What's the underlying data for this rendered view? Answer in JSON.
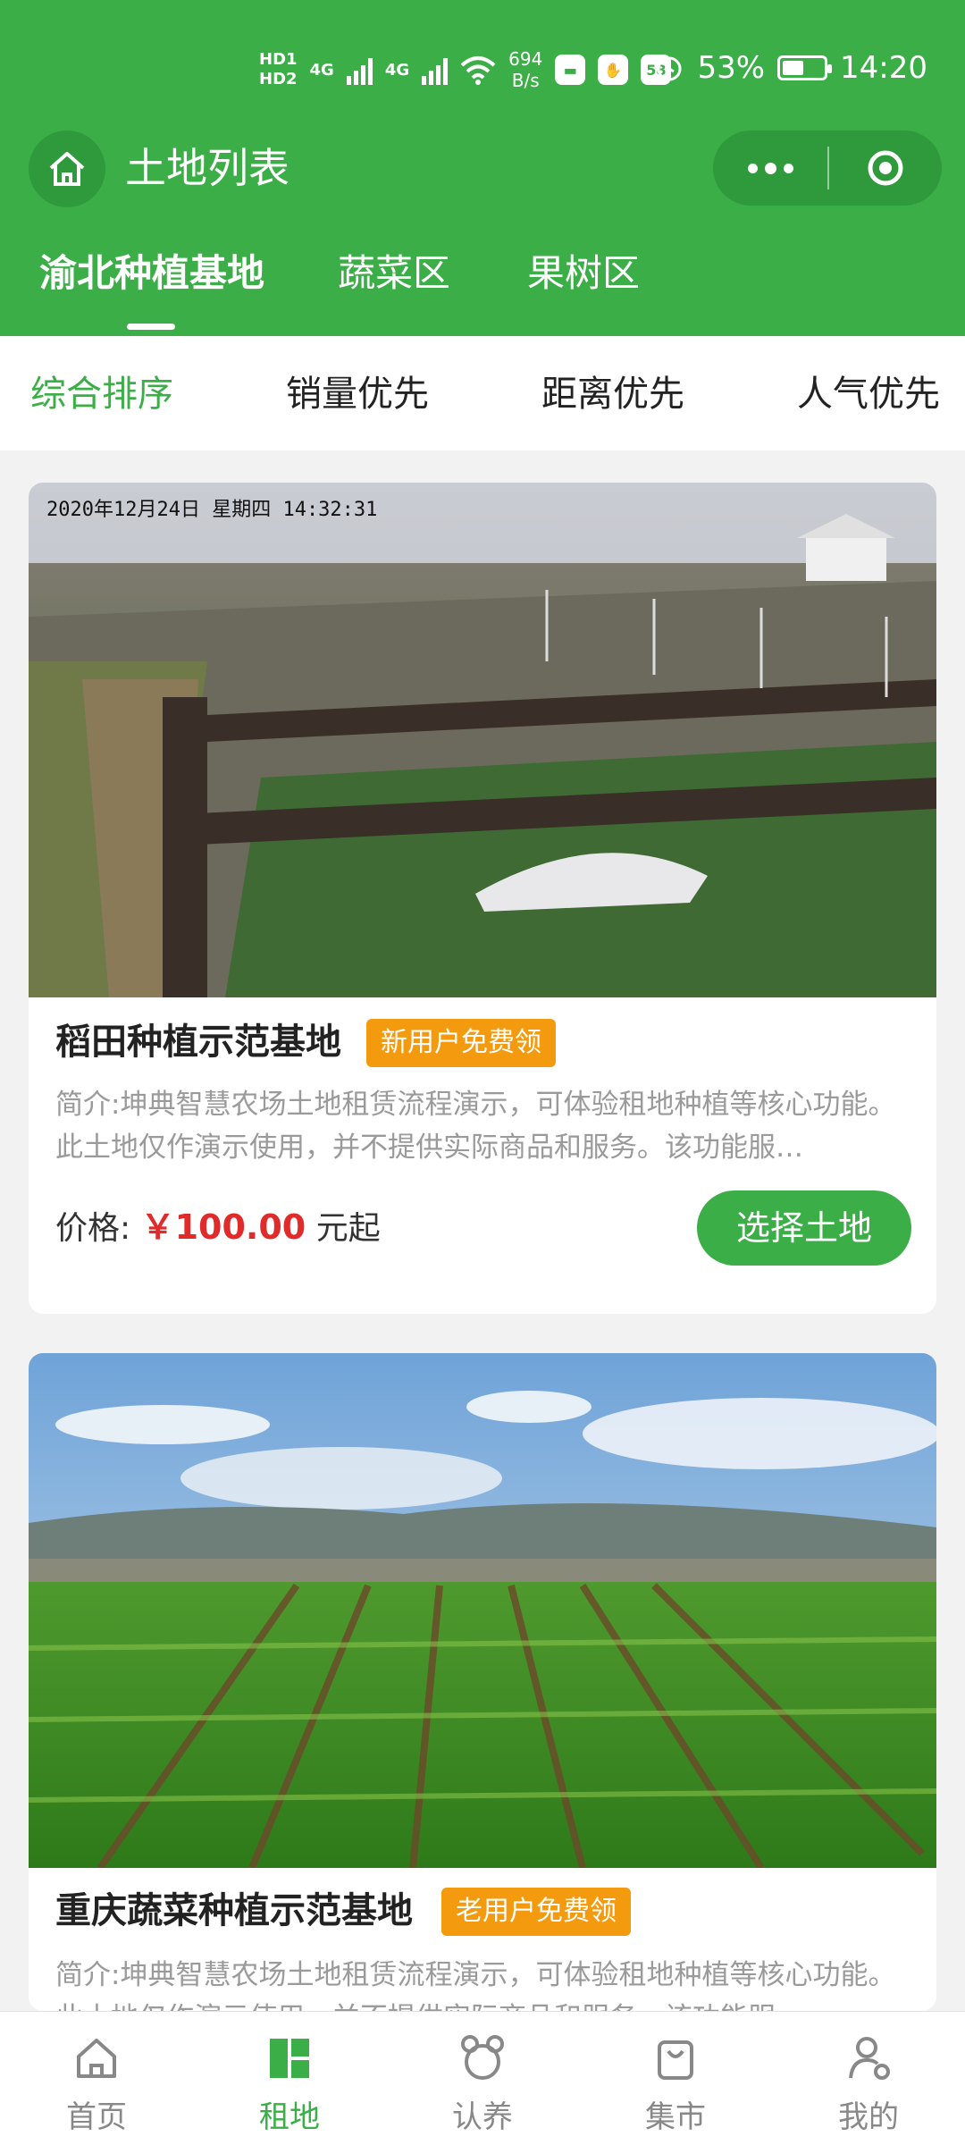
{
  "status_bar": {
    "hd1": "HD1",
    "hd2": "HD2",
    "net1": "4G",
    "net2": "4G",
    "speed_value": "694",
    "speed_unit": "B/s",
    "app_badge": "58",
    "battery": "53%",
    "battery_level": 0.53,
    "time": "14:20"
  },
  "nav": {
    "title": "土地列表"
  },
  "tabs": [
    {
      "label": "渝北种植基地",
      "active": true
    },
    {
      "label": "蔬菜区",
      "active": false
    },
    {
      "label": "果树区",
      "active": false
    }
  ],
  "sort": [
    {
      "label": "综合排序",
      "active": true
    },
    {
      "label": "销量优先",
      "active": false
    },
    {
      "label": "距离优先",
      "active": false
    },
    {
      "label": "人气优先",
      "active": false
    }
  ],
  "cards": [
    {
      "image_timestamp": "2020年12月24日  星期四  14:32:31",
      "title": "稻田种植示范基地",
      "badge": "新用户免费领",
      "desc": "简介:坤典智慧农场土地租赁流程演示，可体验租地种植等核心功能。此土地仅作演示使用，并不提供实际商品和服务。该功能服…",
      "price_label": "价格:",
      "price": "￥100.00",
      "price_unit": "元起",
      "button": "选择土地"
    },
    {
      "title": "重庆蔬菜种植示范基地",
      "badge": "老用户免费领",
      "desc": "简介:坤典智慧农场土地租赁流程演示，可体验租地种植等核心功能。此土地仅作演示使用，并不提供实际商品和服务。该功能服…"
    }
  ],
  "tabbar": [
    {
      "label": "首页",
      "icon": "home-icon",
      "active": false
    },
    {
      "label": "租地",
      "icon": "grid-icon",
      "active": true
    },
    {
      "label": "认养",
      "icon": "bear-icon",
      "active": false
    },
    {
      "label": "集市",
      "icon": "bag-icon",
      "active": false
    },
    {
      "label": "我的",
      "icon": "user-icon",
      "active": false
    }
  ],
  "colors": {
    "brand_green": "#3cae48",
    "badge_orange": "#f39a0e",
    "price_red": "#e12a2a"
  }
}
